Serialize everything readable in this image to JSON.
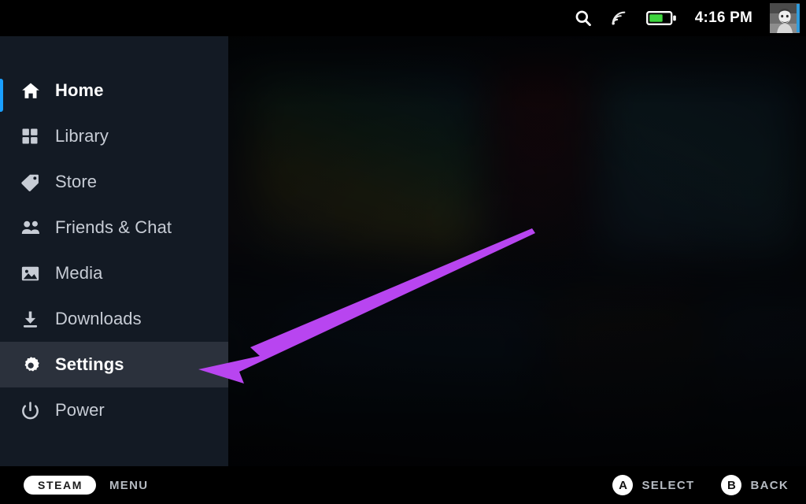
{
  "status_bar": {
    "search_icon": "search-icon",
    "wifi_icon": "wifi-icon",
    "battery_icon": "battery-icon",
    "battery_level_percent": 60,
    "time": "4:16 PM",
    "avatar_icon": "user-avatar",
    "online_status_color": "#2f9bdc"
  },
  "sidebar": {
    "accent_color": "#1a9fff",
    "active_item": "Settings",
    "focused_item": "Home",
    "items": [
      {
        "label": "Home",
        "icon": "home-icon",
        "state": "focused"
      },
      {
        "label": "Library",
        "icon": "grid-icon",
        "state": "normal"
      },
      {
        "label": "Store",
        "icon": "tag-icon",
        "state": "normal"
      },
      {
        "label": "Friends & Chat",
        "icon": "people-icon",
        "state": "normal"
      },
      {
        "label": "Media",
        "icon": "image-icon",
        "state": "normal"
      },
      {
        "label": "Downloads",
        "icon": "download-icon",
        "state": "normal"
      },
      {
        "label": "Settings",
        "icon": "gear-icon",
        "state": "active"
      },
      {
        "label": "Power",
        "icon": "power-icon",
        "state": "normal"
      }
    ]
  },
  "annotation": {
    "arrow_color": "#b845f0",
    "points_at": "Settings"
  },
  "footer": {
    "steam_label": "STEAM",
    "menu_label": "MENU",
    "hints": [
      {
        "button": "A",
        "label": "SELECT"
      },
      {
        "button": "B",
        "label": "BACK"
      }
    ]
  }
}
